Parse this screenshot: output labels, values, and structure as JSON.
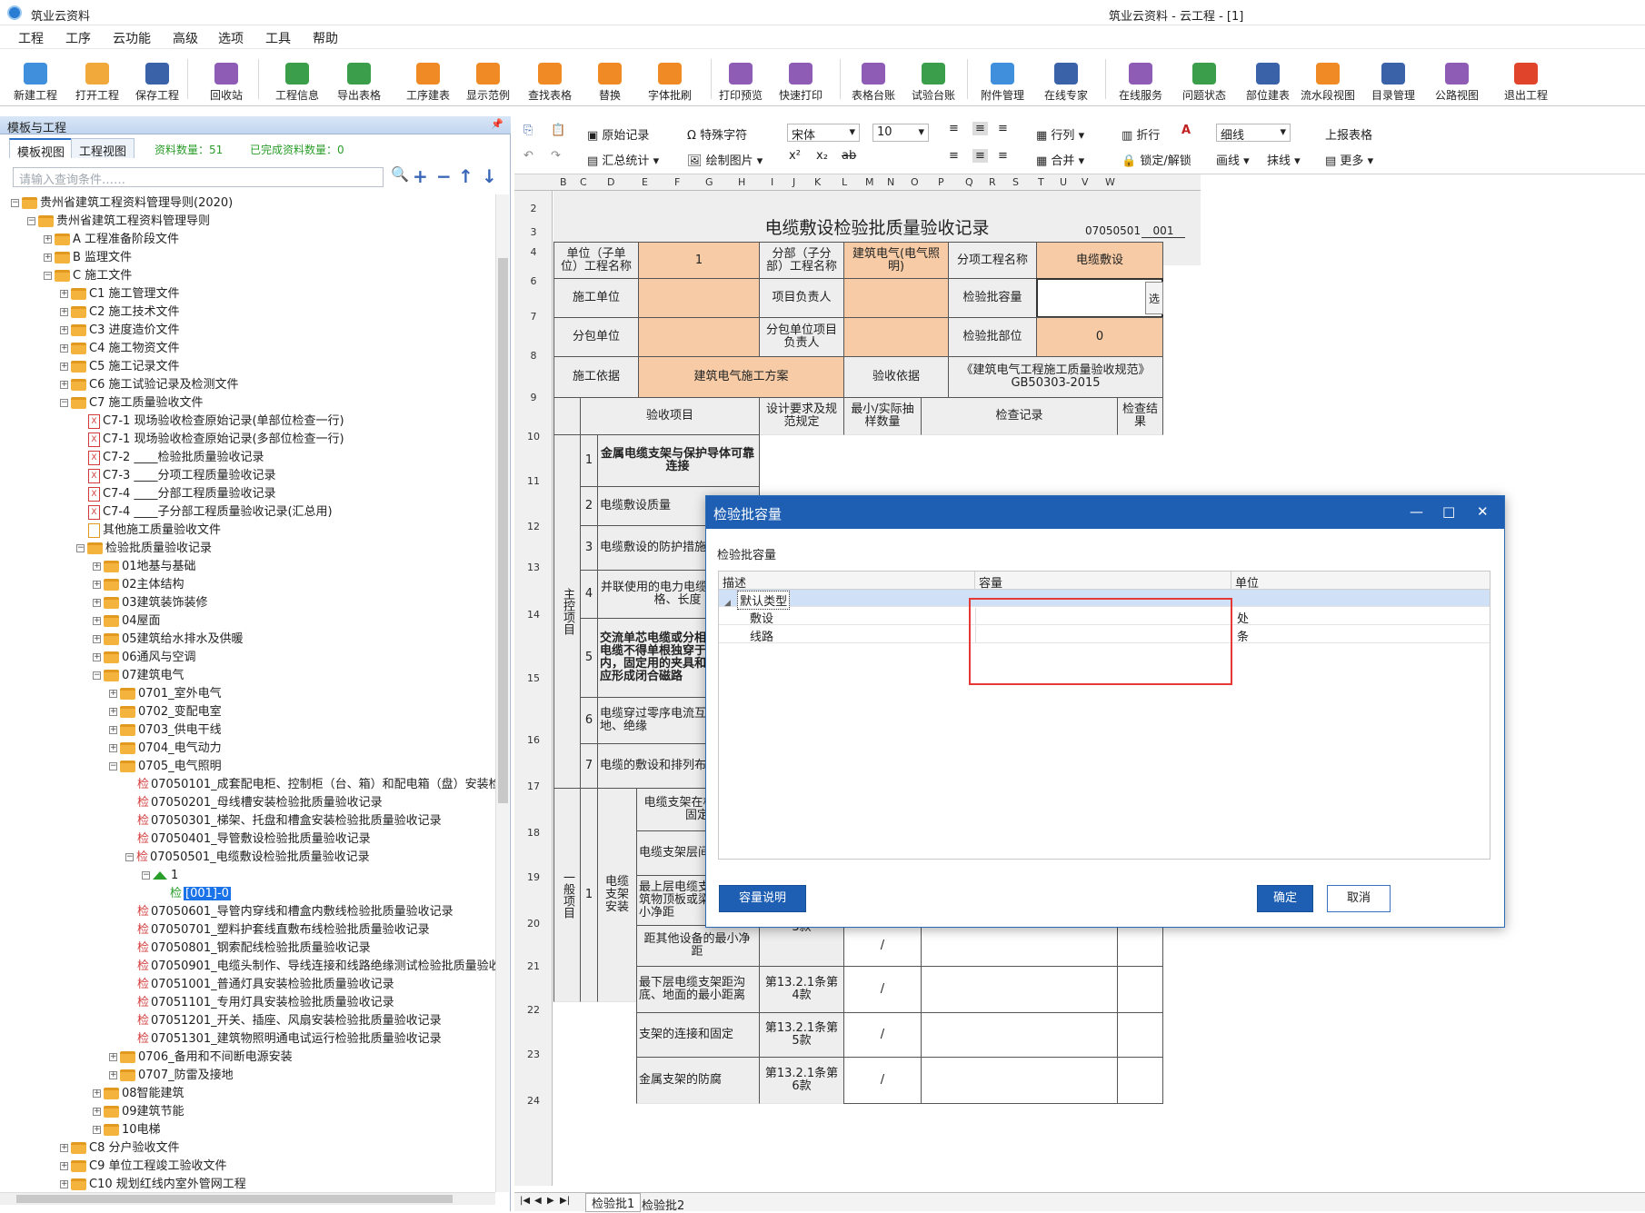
{
  "app": {
    "title": "筑业云资料",
    "doc_title": "筑业云资料 - 云工程 - [1]"
  },
  "menu": [
    "工程",
    "工序",
    "云功能",
    "高级",
    "选项",
    "工具",
    "帮助"
  ],
  "toolbar": [
    {
      "label": "新建工程",
      "icon": "new-project-icon",
      "color": "#3f8fdd"
    },
    {
      "label": "打开工程",
      "icon": "open-folder-icon",
      "color": "#f2a93b"
    },
    {
      "label": "保存工程",
      "icon": "save-icon",
      "color": "#3a62a8"
    },
    {
      "label": "回收站",
      "icon": "recycle-bin-icon",
      "color": "#8e5bb5"
    },
    {
      "label": "工程信息",
      "icon": "info-icon",
      "color": "#3a9e4a"
    },
    {
      "label": "导出表格",
      "icon": "export-table-icon",
      "color": "#3a9e4a"
    },
    {
      "label": "工序建表",
      "icon": "process-table-icon",
      "color": "#f08a24"
    },
    {
      "label": "显示范例",
      "icon": "example-icon",
      "color": "#f08a24"
    },
    {
      "label": "查找表格",
      "icon": "search-table-icon",
      "color": "#f08a24"
    },
    {
      "label": "替换",
      "icon": "replace-icon",
      "color": "#f08a24"
    },
    {
      "label": "字体批刷",
      "icon": "font-brush-icon",
      "color": "#f08a24"
    },
    {
      "label": "打印预览",
      "icon": "print-preview-icon",
      "color": "#8e5bb5"
    },
    {
      "label": "快速打印",
      "icon": "printer-icon",
      "color": "#8e5bb5"
    },
    {
      "label": "表格台账",
      "icon": "table-ledger-icon",
      "color": "#8e5bb5"
    },
    {
      "label": "试验台账",
      "icon": "test-ledger-icon",
      "color": "#3a9e4a"
    },
    {
      "label": "附件管理",
      "icon": "attachment-icon",
      "color": "#3f8fdd"
    },
    {
      "label": "在线专家",
      "icon": "expert-icon",
      "color": "#3a62a8"
    },
    {
      "label": "在线服务",
      "icon": "online-service-icon",
      "color": "#8e5bb5"
    },
    {
      "label": "问题状态",
      "icon": "question-icon",
      "color": "#3a9e4a"
    },
    {
      "label": "部位建表",
      "icon": "grid-icon",
      "color": "#3a62a8"
    },
    {
      "label": "流水段视图",
      "icon": "layers-icon",
      "color": "#f08a24"
    },
    {
      "label": "目录管理",
      "icon": "catalog-icon",
      "color": "#3a62a8"
    },
    {
      "label": "公路视图",
      "icon": "road-icon",
      "color": "#8e5bb5"
    },
    {
      "label": "退出工程",
      "icon": "power-icon",
      "color": "#e0442b"
    }
  ],
  "left_panel": {
    "title": "模板与工程",
    "tabs": [
      "模板视图",
      "工程视图"
    ],
    "count_label": "资料数量：51",
    "done_label": "已完成资料数量：0",
    "search_placeholder": "请输入查询条件……"
  },
  "tree": [
    {
      "label": "贵州省建筑工程资料管理导则(2020)",
      "level": 0,
      "kind": "folder",
      "exp": "-"
    },
    {
      "label": "贵州省建筑工程资料管理导则",
      "level": 1,
      "kind": "folder",
      "exp": "-"
    },
    {
      "label": "A 工程准备阶段文件",
      "level": 2,
      "kind": "folder",
      "exp": "+"
    },
    {
      "label": "B 监理文件",
      "level": 2,
      "kind": "folder",
      "exp": "+"
    },
    {
      "label": "C 施工文件",
      "level": 2,
      "kind": "folder",
      "exp": "-"
    },
    {
      "label": "C1 施工管理文件",
      "level": 3,
      "kind": "folder",
      "exp": "+"
    },
    {
      "label": "C2 施工技术文件",
      "level": 3,
      "kind": "folder",
      "exp": "+"
    },
    {
      "label": "C3 进度造价文件",
      "level": 3,
      "kind": "folder",
      "exp": "+"
    },
    {
      "label": "C4 施工物资文件",
      "level": 3,
      "kind": "folder",
      "exp": "+"
    },
    {
      "label": "C5 施工记录文件",
      "level": 3,
      "kind": "folder",
      "exp": "+"
    },
    {
      "label": "C6 施工试验记录及检测文件",
      "level": 3,
      "kind": "folder",
      "exp": "+"
    },
    {
      "label": "C7 施工质量验收文件",
      "level": 3,
      "kind": "folder",
      "exp": "-"
    },
    {
      "label": "C7-1 现场验收检查原始记录(单部位检查一行)",
      "level": 4,
      "kind": "doc"
    },
    {
      "label": "C7-1 现场验收检查原始记录(多部位检查一行)",
      "level": 4,
      "kind": "doc"
    },
    {
      "label": "C7-2 ____检验批质量验收记录",
      "level": 4,
      "kind": "doc"
    },
    {
      "label": "C7-3 ____分项工程质量验收记录",
      "level": 4,
      "kind": "doc"
    },
    {
      "label": "C7-4 ____分部工程质量验收记录",
      "level": 4,
      "kind": "doc"
    },
    {
      "label": "C7-4 ____子分部工程质量验收记录(汇总用)",
      "level": 4,
      "kind": "doc"
    },
    {
      "label": "其他施工质量验收文件",
      "level": 4,
      "kind": "doc2"
    },
    {
      "label": "检验批质量验收记录",
      "level": 4,
      "kind": "folder",
      "exp": "-"
    },
    {
      "label": "01地基与基础",
      "level": 5,
      "kind": "folder",
      "exp": "+"
    },
    {
      "label": "02主体结构",
      "level": 5,
      "kind": "folder",
      "exp": "+"
    },
    {
      "label": "03建筑装饰装修",
      "level": 5,
      "kind": "folder",
      "exp": "+"
    },
    {
      "label": "04屋面",
      "level": 5,
      "kind": "folder",
      "exp": "+"
    },
    {
      "label": "05建筑给水排水及供暖",
      "level": 5,
      "kind": "folder",
      "exp": "+"
    },
    {
      "label": "06通风与空调",
      "level": 5,
      "kind": "folder",
      "exp": "+"
    },
    {
      "label": "07建筑电气",
      "level": 5,
      "kind": "folder",
      "exp": "-"
    },
    {
      "label": "0701_室外电气",
      "level": 6,
      "kind": "folder",
      "exp": "+"
    },
    {
      "label": "0702_变配电室",
      "level": 6,
      "kind": "folder",
      "exp": "+"
    },
    {
      "label": "0703_供电干线",
      "level": 6,
      "kind": "folder",
      "exp": "+"
    },
    {
      "label": "0704_电气动力",
      "level": 6,
      "kind": "folder",
      "exp": "+"
    },
    {
      "label": "0705_电气照明",
      "level": 6,
      "kind": "folder",
      "exp": "-"
    },
    {
      "label": "07050101_成套配电柜、控制柜（台、箱）和配电箱（盘）安装检验批",
      "level": 7,
      "kind": "jian"
    },
    {
      "label": "07050201_母线槽安装检验批质量验收记录",
      "level": 7,
      "kind": "jian"
    },
    {
      "label": "07050301_梯架、托盘和槽盒安装检验批质量验收记录",
      "level": 7,
      "kind": "jian"
    },
    {
      "label": "07050401_导管敷设检验批质量验收记录",
      "level": 7,
      "kind": "jian"
    },
    {
      "label": "07050501_电缆敷设检验批质量验收记录",
      "level": 7,
      "kind": "jian",
      "exp": "-"
    },
    {
      "label": "1",
      "level": 8,
      "kind": "home",
      "exp": "-"
    },
    {
      "label": "[001]-0",
      "level": 9,
      "kind": "jiansel"
    },
    {
      "label": "07050601_导管内穿线和槽盒内敷线检验批质量验收记录",
      "level": 7,
      "kind": "jian"
    },
    {
      "label": "07050701_塑料护套线直敷布线检验批质量验收记录",
      "level": 7,
      "kind": "jian"
    },
    {
      "label": "07050801_钢索配线检验批质量验收记录",
      "level": 7,
      "kind": "jian"
    },
    {
      "label": "07050901_电缆头制作、导线连接和线路绝缘测试检验批质量验收记录",
      "level": 7,
      "kind": "jian"
    },
    {
      "label": "07051001_普通灯具安装检验批质量验收记录",
      "level": 7,
      "kind": "jian"
    },
    {
      "label": "07051101_专用灯具安装检验批质量验收记录",
      "level": 7,
      "kind": "jian"
    },
    {
      "label": "07051201_开关、插座、风扇安装检验批质量验收记录",
      "level": 7,
      "kind": "jian"
    },
    {
      "label": "07051301_建筑物照明通电试运行检验批质量验收记录",
      "level": 7,
      "kind": "jian"
    },
    {
      "label": "0706_备用和不间断电源安装",
      "level": 6,
      "kind": "folder",
      "exp": "+"
    },
    {
      "label": "0707_防雷及接地",
      "level": 6,
      "kind": "folder",
      "exp": "+"
    },
    {
      "label": "08智能建筑",
      "level": 5,
      "kind": "folder",
      "exp": "+"
    },
    {
      "label": "09建筑节能",
      "level": 5,
      "kind": "folder",
      "exp": "+"
    },
    {
      "label": "10电梯",
      "level": 5,
      "kind": "folder",
      "exp": "+"
    },
    {
      "label": "C8 分户验收文件",
      "level": 3,
      "kind": "folder",
      "exp": "+"
    },
    {
      "label": "C9 单位工程竣工验收文件",
      "level": 3,
      "kind": "folder",
      "exp": "+"
    },
    {
      "label": "C10 规划红线内室外管网工程",
      "level": 3,
      "kind": "folder",
      "exp": "+"
    }
  ],
  "format_bar": {
    "raw_record": "原始记录",
    "special_char": "特殊字符",
    "font": "宋体",
    "size": "10",
    "row_col": "行列",
    "wrap": "折行",
    "line_style": "细线",
    "report": "上报表格",
    "summary": "汇总统计",
    "draw_image": "绘制图片",
    "merge": "合并",
    "lock": "锁定/解锁",
    "draw_line": "画线",
    "erase_line": "抹线",
    "more": "更多"
  },
  "col_headers": [
    "B",
    "C",
    "D",
    "E",
    "F",
    "G",
    "H",
    "I",
    "J",
    "K",
    "L",
    "M",
    "N",
    "O",
    "P",
    "Q",
    "R",
    "S",
    "T",
    "U",
    "V",
    "W"
  ],
  "row_headers": [
    "2",
    "3",
    "4",
    "6",
    "7",
    "8",
    "9",
    "10",
    "11",
    "12",
    "13",
    "14",
    "15",
    "16",
    "17",
    "18",
    "19",
    "20",
    "21",
    "22",
    "23",
    "24"
  ],
  "form": {
    "title": "电缆敷设检验批质量验收记录",
    "code": "07050501",
    "code_no": "001",
    "unit_label": "单位（子单位）工程名称",
    "unit_val": "1",
    "sub_label": "分部（子分部）工程名称",
    "sub_val": "建筑电气(电气照明)",
    "item_label": "分项工程名称",
    "item_val": "电缆敷设",
    "contractor": "施工单位",
    "pm": "项目负责人",
    "capacity": "检验批容量",
    "select": "选",
    "subcontractor": "分包单位",
    "sub_pm": "分包单位项目负责人",
    "part": "检验批部位",
    "part_val": "0",
    "basis": "施工依据",
    "basis_val": "建筑电气施工方案",
    "accept_basis": "验收依据",
    "accept_basis_val": "《建筑电气工程施工质量验收规范》GB50303-2015",
    "h_item": "验收项目",
    "h_design": "设计要求及规范规定",
    "h_min": "最小/实际抽样数量",
    "h_record": "检查记录",
    "h_result": "检查结果",
    "main_items": "主控项目",
    "general_items": "一般项目",
    "r11": "金属电缆支架与保护导体可靠连接",
    "r12": "电缆敷设质量",
    "r13": "电缆敷设的防护措施",
    "r14": "并联使用的电力电缆型号、规格、长度",
    "r15": "交流单芯电缆或分相后的每相电缆不得单根独穿于钢导管内，固定用的夹具和支架，不应形成闭合磁路",
    "r16": "电缆穿过零序电流互感器的接地、绝缘",
    "r17": "电缆的敷设和排列布置",
    "g_group": "电缆支架安装",
    "g18": "电缆支架在构件上的固定",
    "g19": "电缆支架层间距离",
    "g20": "最上层电缆支架距构筑物顶板或梁底的最小净距",
    "g21": "距其他设备的最小净距",
    "g22": "最下层电缆支架距沟底、地面的最小距离",
    "g23": "支架的连接和固定",
    "g24": "金属支架的防腐",
    "c20": "第13.2.1条第3款",
    "c22": "第13.2.1条第4款",
    "c23": "第13.2.1条第5款",
    "c24": "第13.2.1条第6款",
    "slash": "/"
  },
  "sheets": [
    "检验批1",
    "检验批2"
  ],
  "dialog": {
    "title": "检验批容量",
    "label": "检验批容量",
    "cols": [
      "描述",
      "容量",
      "单位"
    ],
    "rows": [
      {
        "desc": "默认类型",
        "cap": "",
        "unit": ""
      },
      {
        "desc": "敷设",
        "cap": "",
        "unit": "处"
      },
      {
        "desc": "线路",
        "cap": "",
        "unit": "条"
      }
    ],
    "btn_help": "容量说明",
    "btn_ok": "确定",
    "btn_cancel": "取消"
  }
}
